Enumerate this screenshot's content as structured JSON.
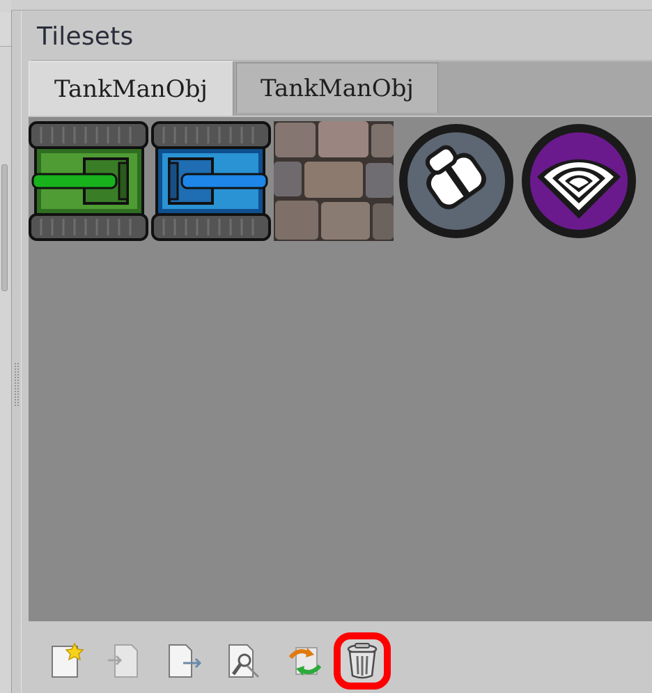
{
  "panel": {
    "title": "Tilesets"
  },
  "tabs": [
    {
      "label": "TankManObj",
      "active": true
    },
    {
      "label": "TankManObj",
      "active": false
    }
  ],
  "tiles": [
    {
      "name": "green-tank",
      "color": "#3c9a2c"
    },
    {
      "name": "blue-tank",
      "color": "#1a6fc9"
    },
    {
      "name": "stone-brick-wall"
    },
    {
      "name": "gray-shield-badge",
      "color": "#5d6673"
    },
    {
      "name": "purple-wifi-badge",
      "color": "#6a1a8c"
    }
  ],
  "toolbar": {
    "buttons": [
      {
        "icon": "new-tileset-icon"
      },
      {
        "icon": "import-tileset-icon"
      },
      {
        "icon": "export-tileset-icon"
      },
      {
        "icon": "tileset-properties-icon"
      },
      {
        "icon": "reload-tileset-icon"
      },
      {
        "icon": "remove-tileset-icon",
        "highlighted": true
      }
    ]
  }
}
